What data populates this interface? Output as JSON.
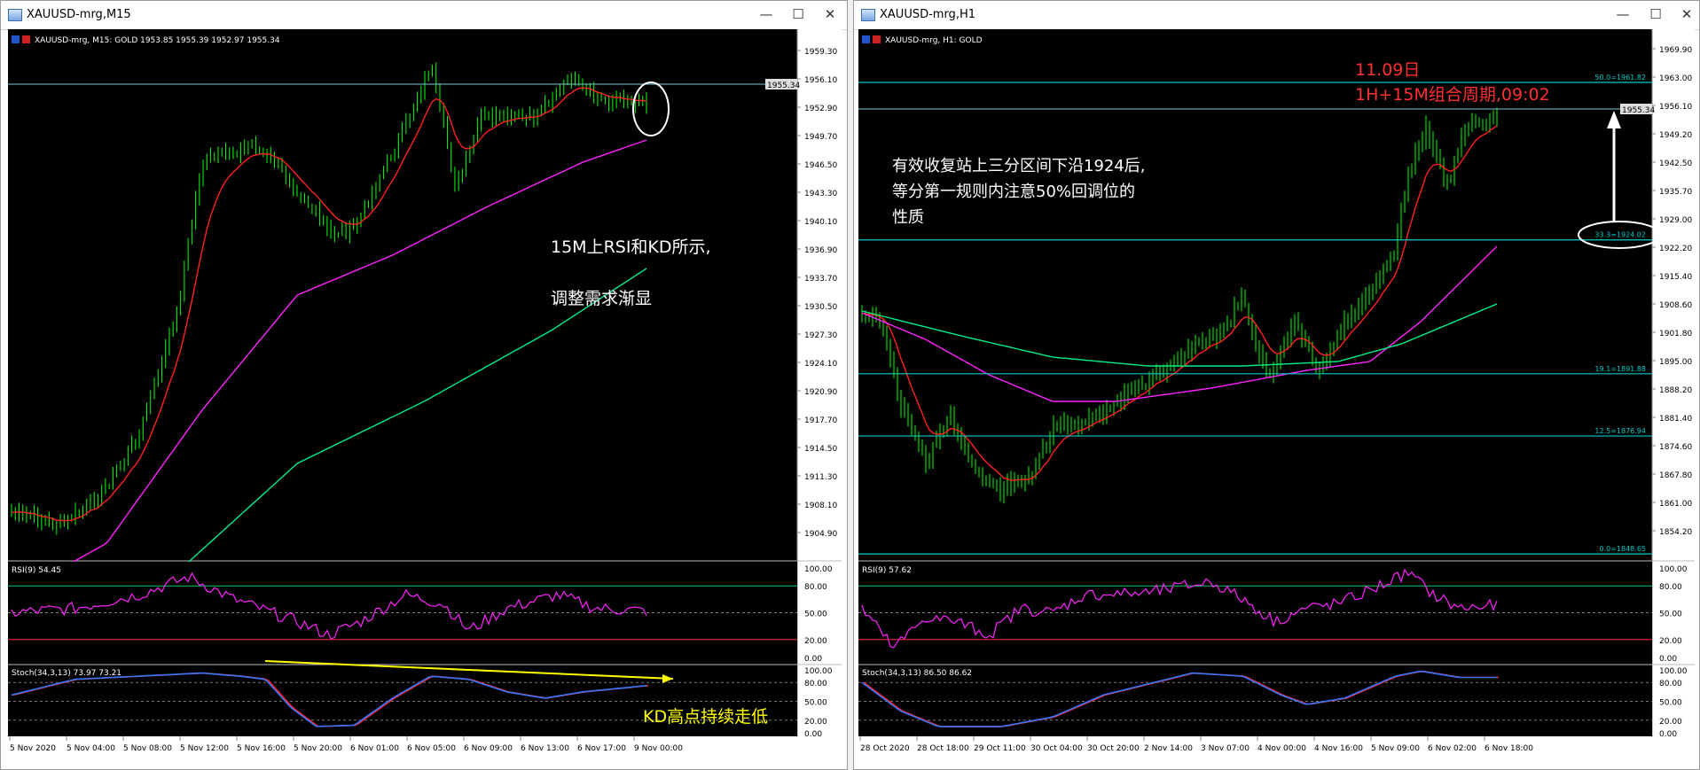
{
  "windows": [
    {
      "id": "m15",
      "title": "XAUUSD-mrg,M15",
      "controls": {
        "minimize": "—",
        "maximize": "☐",
        "close": "✕"
      },
      "header": "XAUUSD-mrg, M15:  GOLD  1953.85 1955.39 1952.97 1955.34",
      "price_labels": [
        "1959.30",
        "1956.10",
        "1952.90",
        "1949.70",
        "1946.50",
        "1943.30",
        "1940.10",
        "1936.90",
        "1933.70",
        "1930.50",
        "1927.30",
        "1924.10",
        "1920.90",
        "1917.70",
        "1914.50",
        "1911.30",
        "1908.10",
        "1904.90"
      ],
      "current_price": "1955.34",
      "annotations": [
        "15M上RSI和KD所示,",
        "调整需求渐显",
        "KD高点持续走低"
      ],
      "rsi": {
        "label": "RSI(9) 54.45",
        "levels": [
          "100.00",
          "80.00",
          "50.00",
          "20.00",
          "0.00"
        ]
      },
      "stoch": {
        "label": "Stoch(34,3,13) 73.97 73.21",
        "levels": [
          "100.00",
          "80.00",
          "50.00",
          "20.00",
          "0.00"
        ]
      },
      "time_labels": [
        "5 Nov 2020",
        "5 Nov 04:00",
        "5 Nov 08:00",
        "5 Nov 12:00",
        "5 Nov 16:00",
        "5 Nov 20:00",
        "6 Nov 01:00",
        "6 Nov 05:00",
        "6 Nov 09:00",
        "6 Nov 13:00",
        "6 Nov 17:00",
        "9 Nov 00:00"
      ]
    },
    {
      "id": "h1",
      "title": "XAUUSD-mrg,H1",
      "controls": {
        "minimize": "—",
        "maximize": "☐",
        "close": "✕"
      },
      "header": "XAUUSD-mrg, H1:  GOLD",
      "price_labels": [
        "1969.90",
        "1963.00",
        "1956.10",
        "1949.20",
        "1942.50",
        "1935.70",
        "1929.00",
        "1922.20",
        "1915.40",
        "1908.60",
        "1901.80",
        "1895.00",
        "1888.20",
        "1881.40",
        "1874.60",
        "1867.80",
        "1861.00",
        "1854.20"
      ],
      "current_price": "1955.34",
      "fib_levels": [
        {
          "label": "50.0=1961.82",
          "value": 1961.82
        },
        {
          "label": "33.3=1924.02",
          "value": 1924.02
        },
        {
          "label": "19.1=1891.88",
          "value": 1891.88
        },
        {
          "label": "12.5=1876.94",
          "value": 1876.94
        },
        {
          "label": "0.0=1848.65",
          "value": 1848.65
        }
      ],
      "annotations": [
        "11.09日",
        "1H+15M组合周期,09:02",
        "有效收复站上三分区间下沿1924后,",
        "等分第一规则内注意50%回调位的",
        "性质"
      ],
      "rsi": {
        "label": "RSI(9) 57.62",
        "levels": [
          "100.00",
          "80.00",
          "50.00",
          "20.00",
          "0.00"
        ]
      },
      "stoch": {
        "label": "Stoch(34,3,13) 86.50 86.62",
        "levels": [
          "100.00",
          "80.00",
          "50.00",
          "20.00",
          "0.00"
        ]
      },
      "time_labels": [
        "28 Oct 2020",
        "28 Oct 18:00",
        "29 Oct 11:00",
        "30 Oct 04:00",
        "30 Oct 20:00",
        "2 Nov 14:00",
        "3 Nov 07:00",
        "4 Nov 00:00",
        "4 Nov 16:00",
        "5 Nov 09:00",
        "6 Nov 02:00",
        "6 Nov 18:00"
      ]
    }
  ],
  "colors": {
    "background": "#000000",
    "candle": "#00ff00",
    "ma_fast": "#ff2020",
    "ma_mid": "#ff22ff",
    "ma_slow": "#00ee88",
    "level_line": "#7ec8d8",
    "fib_line": "#00c8c8",
    "annotation_white": "#ffffff",
    "annotation_red": "#ff3030",
    "annotation_yellow": "#ffff00",
    "stoch_main": "#3377ff",
    "stoch_signal": "#ff2020"
  }
}
